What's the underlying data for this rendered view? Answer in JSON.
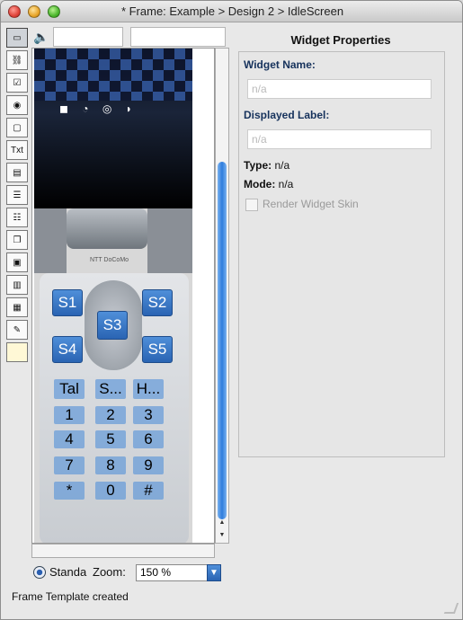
{
  "window": {
    "title": "* Frame: Example > Design 2 >  IdleScreen"
  },
  "toolbar": {
    "tools": [
      {
        "icon": "rectangle-tool-icon"
      },
      {
        "icon": "link-tool-icon"
      },
      {
        "icon": "checkbox-tool-icon"
      },
      {
        "icon": "radio-tool-icon"
      },
      {
        "icon": "frame-tool-icon"
      },
      {
        "label": "Txt",
        "icon": "text-tool-icon"
      },
      {
        "icon": "panel-tool-icon"
      },
      {
        "icon": "list-tool-icon"
      },
      {
        "icon": "list-tool-2-icon"
      },
      {
        "icon": "duplicate-tool-icon"
      },
      {
        "icon": "document-tool-icon"
      },
      {
        "icon": "document-tool-2-icon"
      },
      {
        "icon": "table-tool-icon"
      },
      {
        "icon": "paint-tool-icon"
      },
      {
        "icon": "note-tool-icon"
      }
    ]
  },
  "phone": {
    "softkeys": [
      "S1",
      "S2",
      "S3",
      "S4",
      "S5"
    ],
    "keys": [
      [
        "Tal",
        "S...",
        "H..."
      ],
      [
        "1",
        "2",
        "3"
      ],
      [
        "4",
        "5",
        "6"
      ],
      [
        "7",
        "8",
        "9"
      ],
      [
        "*",
        "0",
        "#"
      ]
    ],
    "brand_text": "NTT DoCoMo"
  },
  "bottom": {
    "radio_label": "Standa",
    "zoom_label": "Zoom:",
    "zoom_value": "150 %"
  },
  "status": {
    "text": "Frame Template created"
  },
  "properties": {
    "title": "Widget Properties",
    "widget_name_label": "Widget Name:",
    "widget_name_value": "n/a",
    "displayed_label_label": "Displayed Label:",
    "displayed_label_value": "n/a",
    "type_label": "Type:",
    "type_value": "n/a",
    "mode_label": "Mode:",
    "mode_value": "n/a",
    "render_skin_label": "Render Widget Skin"
  },
  "colors": {
    "accent": "#2f7ddd",
    "label_blue": "#16325c"
  }
}
